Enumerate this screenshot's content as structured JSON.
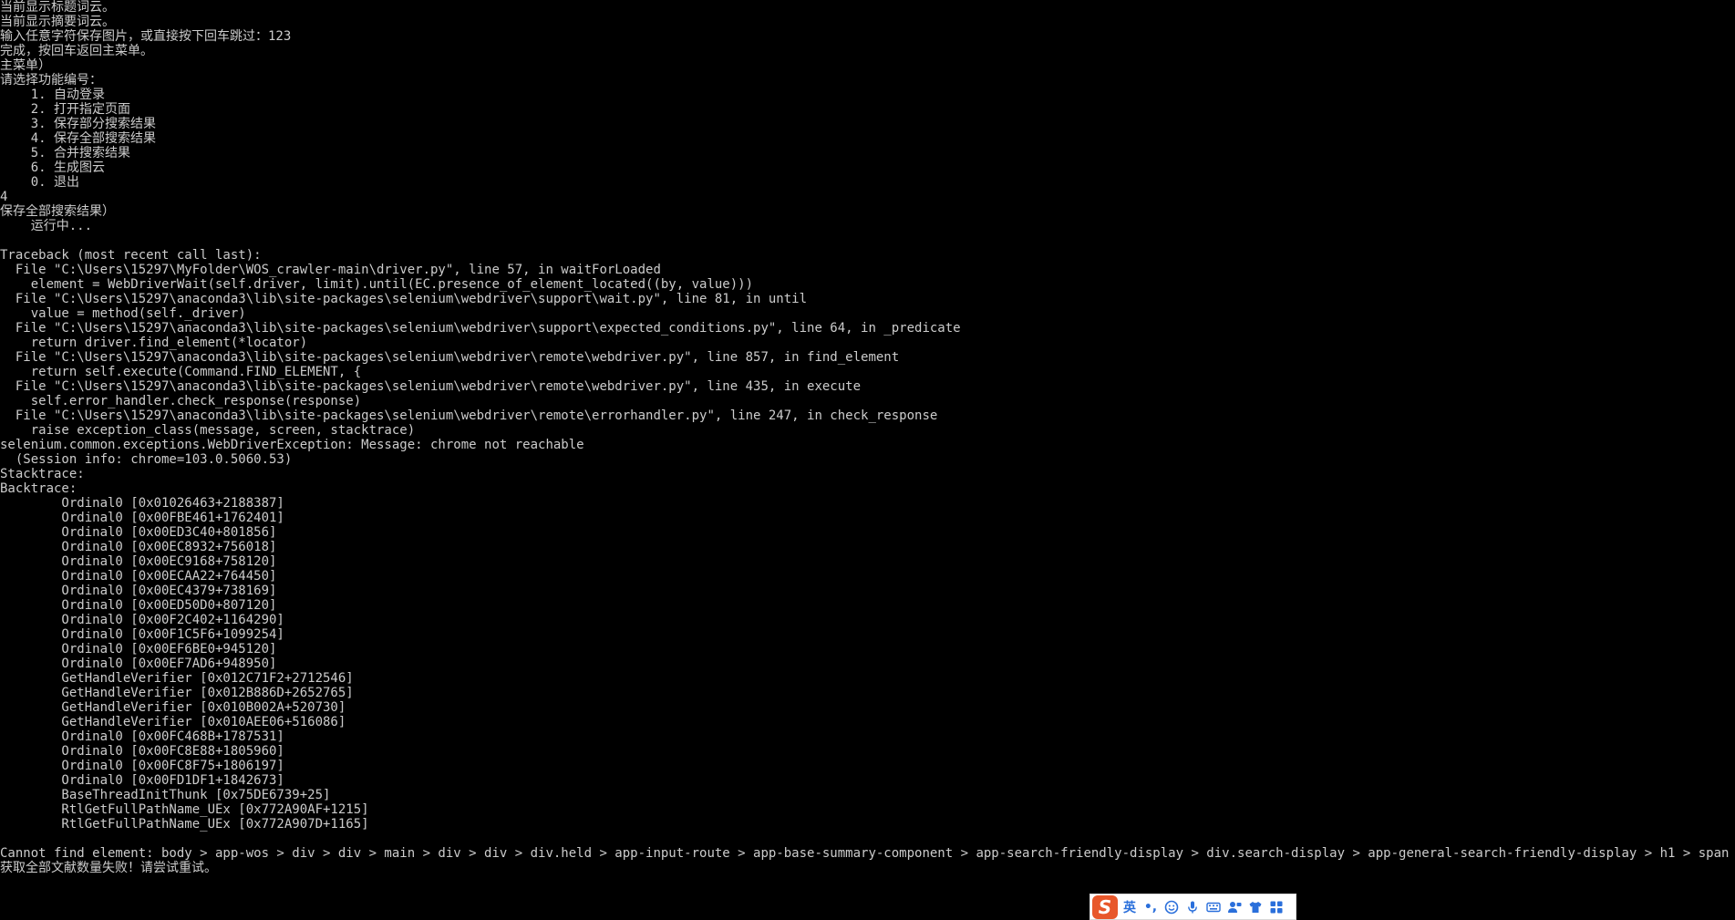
{
  "console": {
    "lines": [
      "当前显示标题词云。",
      "当前显示摘要词云。",
      "输入任意字符保存图片，或直接按下回车跳过：123",
      "完成，按回车返回主菜单。",
      "主菜单）",
      "请选择功能编号：",
      "    1. 自动登录",
      "    2. 打开指定页面",
      "    3. 保存部分搜索结果",
      "    4. 保存全部搜索结果",
      "    5. 合并搜索结果",
      "    6. 生成图云",
      "    0. 退出",
      "4",
      "保存全部搜索结果）",
      "    运行中...",
      "",
      "Traceback (most recent call last):",
      "  File \"C:\\Users\\15297\\MyFolder\\WOS_crawler-main\\driver.py\", line 57, in waitForLoaded",
      "    element = WebDriverWait(self.driver, limit).until(EC.presence_of_element_located((by, value)))",
      "  File \"C:\\Users\\15297\\anaconda3\\lib\\site-packages\\selenium\\webdriver\\support\\wait.py\", line 81, in until",
      "    value = method(self._driver)",
      "  File \"C:\\Users\\15297\\anaconda3\\lib\\site-packages\\selenium\\webdriver\\support\\expected_conditions.py\", line 64, in _predicate",
      "    return driver.find_element(*locator)",
      "  File \"C:\\Users\\15297\\anaconda3\\lib\\site-packages\\selenium\\webdriver\\remote\\webdriver.py\", line 857, in find_element",
      "    return self.execute(Command.FIND_ELEMENT, {",
      "  File \"C:\\Users\\15297\\anaconda3\\lib\\site-packages\\selenium\\webdriver\\remote\\webdriver.py\", line 435, in execute",
      "    self.error_handler.check_response(response)",
      "  File \"C:\\Users\\15297\\anaconda3\\lib\\site-packages\\selenium\\webdriver\\remote\\errorhandler.py\", line 247, in check_response",
      "    raise exception_class(message, screen, stacktrace)",
      "selenium.common.exceptions.WebDriverException: Message: chrome not reachable",
      "  (Session info: chrome=103.0.5060.53)",
      "Stacktrace:",
      "Backtrace:",
      "        Ordinal0 [0x01026463+2188387]",
      "        Ordinal0 [0x00FBE461+1762401]",
      "        Ordinal0 [0x00ED3C40+801856]",
      "        Ordinal0 [0x00EC8932+756018]",
      "        Ordinal0 [0x00EC9168+758120]",
      "        Ordinal0 [0x00ECAA22+764450]",
      "        Ordinal0 [0x00EC4379+738169]",
      "        Ordinal0 [0x00ED50D0+807120]",
      "        Ordinal0 [0x00F2C402+1164290]",
      "        Ordinal0 [0x00F1C5F6+1099254]",
      "        Ordinal0 [0x00EF6BE0+945120]",
      "        Ordinal0 [0x00EF7AD6+948950]",
      "        GetHandleVerifier [0x012C71F2+2712546]",
      "        GetHandleVerifier [0x012B886D+2652765]",
      "        GetHandleVerifier [0x010B002A+520730]",
      "        GetHandleVerifier [0x010AEE06+516086]",
      "        Ordinal0 [0x00FC468B+1787531]",
      "        Ordinal0 [0x00FC8E88+1805960]",
      "        Ordinal0 [0x00FC8F75+1806197]",
      "        Ordinal0 [0x00FD1DF1+1842673]",
      "        BaseThreadInitThunk [0x75DE6739+25]",
      "        RtlGetFullPathName_UEx [0x772A90AF+1215]",
      "        RtlGetFullPathName_UEx [0x772A907D+1165]",
      "",
      "Cannot find element: body > app-wos > div > div > main > div > div > div.held > app-input-route > app-base-summary-component > app-search-friendly-display > div.search-display > app-general-search-friendly-display > h1 > span",
      "获取全部文献数量失败！请尝试重试。"
    ]
  },
  "ime": {
    "logo": "S",
    "mode_label": "英",
    "punct": "•,",
    "icons": [
      "emoji-icon",
      "microphone-icon",
      "keyboard-icon",
      "user-voice-icon",
      "skin-icon",
      "toolbox-icon"
    ]
  },
  "colors": {
    "background": "#000000",
    "text": "#cccccc",
    "ime_accent": "#2a6fdb",
    "ime_logo": "#e8572a"
  }
}
